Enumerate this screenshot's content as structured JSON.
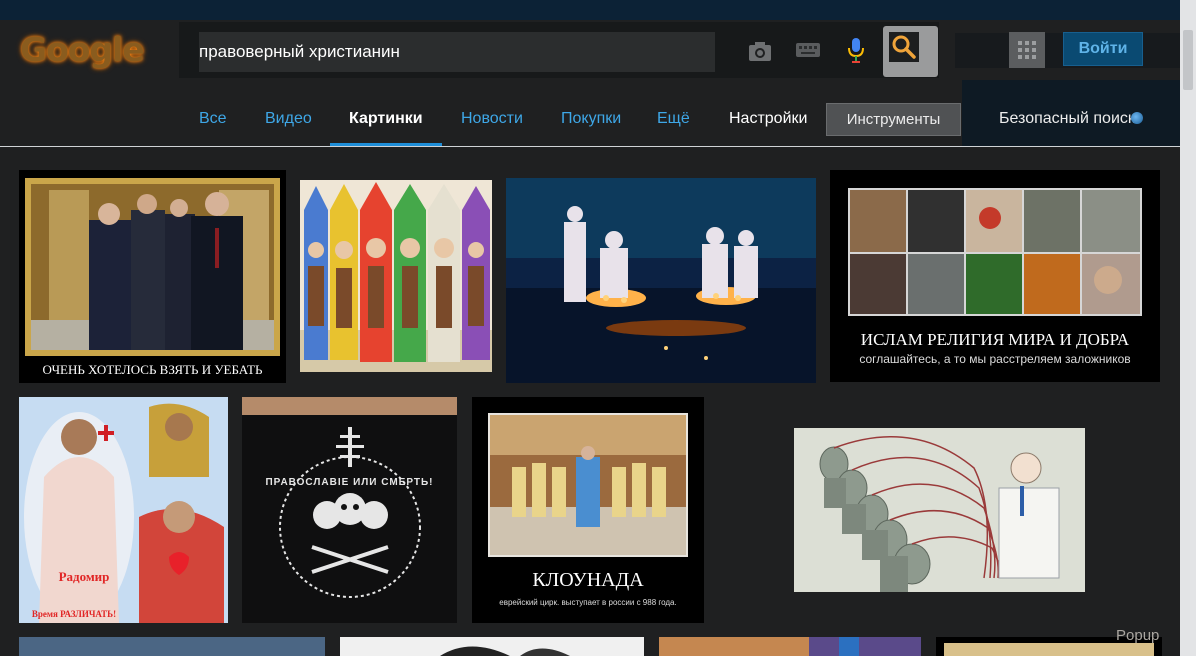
{
  "header": {
    "logo": "Google",
    "search": {
      "value": "правоверный христианин",
      "placeholder": ""
    },
    "login_label": "Войти"
  },
  "nav": {
    "tabs": [
      {
        "label": "Все"
      },
      {
        "label": "Видео"
      },
      {
        "label": "Картинки",
        "active": true
      },
      {
        "label": "Новости"
      },
      {
        "label": "Покупки"
      },
      {
        "label": "Ещё"
      },
      {
        "label": "Настройки"
      }
    ],
    "tools_label": "Инструменты",
    "safe_search_label": "Безопасный поиск"
  },
  "results": {
    "img1": {
      "caption": "ОЧЕНЬ ХОТЕЛОСЬ ВЗЯТЬ И УЕБАТЬ"
    },
    "img4": {
      "caption": "ИСЛАМ РЕЛИГИЯ МИРА И ДОБРА",
      "sub": "соглашайтесь, а то мы расстреляем заложников"
    },
    "img5": {
      "line1": "Радомир",
      "line2": "Время РАЗЛИЧАТЬ!"
    },
    "img6": {
      "text": "ПРАВОСЛАВІЕ ИЛИ СМЕРТЬ!"
    },
    "img7": {
      "caption": "КЛОУНАДА",
      "sub": "еврейский цирк. выступает в россии с 988 года."
    }
  },
  "footer": {
    "popup_label": "Popup"
  },
  "colors": {
    "accent": "#3ea7e7",
    "background": "#1f2021",
    "top_strip": "#0c2236"
  }
}
